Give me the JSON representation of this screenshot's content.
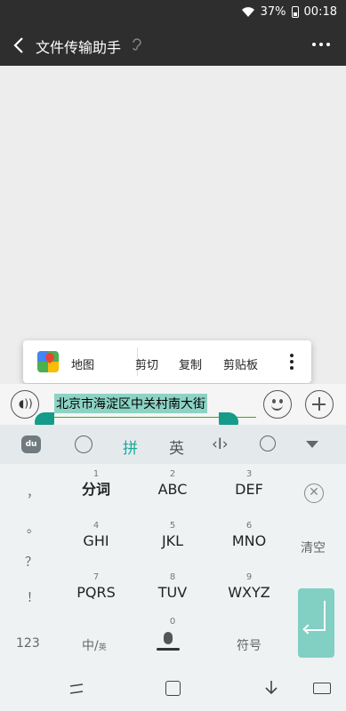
{
  "status": {
    "battery": "37%",
    "time": "00:18"
  },
  "header": {
    "title": "文件传输助手"
  },
  "popup": {
    "map_label": "地图",
    "cut_label": "剪切",
    "copy_label": "复制",
    "clipboard_label": "剪贴板"
  },
  "input": {
    "selected_text": "北京市海淀区中关村南大街"
  },
  "keyboard_toolbar": {
    "logo": "du",
    "pinyin": "拼",
    "english": "英",
    "cursor": "‹I›"
  },
  "keyboard": {
    "punct": [
      "，",
      "。",
      "？",
      "！"
    ],
    "keys": [
      {
        "num": "1",
        "label": "分词"
      },
      {
        "num": "2",
        "label": "ABC"
      },
      {
        "num": "3",
        "label": "DEF"
      },
      {
        "num": "4",
        "label": "GHI"
      },
      {
        "num": "5",
        "label": "JKL"
      },
      {
        "num": "6",
        "label": "MNO"
      },
      {
        "num": "7",
        "label": "PQRS"
      },
      {
        "num": "8",
        "label": "TUV"
      },
      {
        "num": "9",
        "label": "WXYZ"
      }
    ],
    "zero_num": "0",
    "clear": "清空",
    "num_switch": "123",
    "lang_switch": "中/",
    "lang_switch_sub": "英",
    "symbols": "符号"
  }
}
